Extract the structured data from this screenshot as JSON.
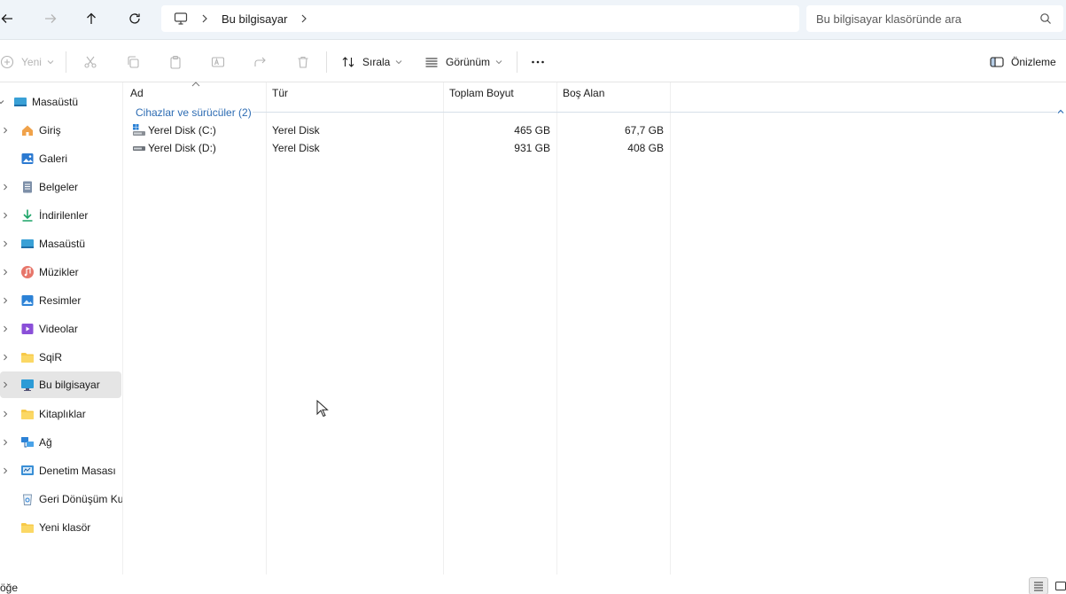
{
  "address": {
    "location": "Bu bilgisayar",
    "search_placeholder": "Bu bilgisayar klasöründe ara"
  },
  "toolbar": {
    "new_label": "Yeni",
    "sort_label": "Sırala",
    "view_label": "Görünüm",
    "preview_label": "Önizleme"
  },
  "sidebar": {
    "items": [
      {
        "label": "Masaüstü",
        "icon": "desktop-icon"
      },
      {
        "label": "Giriş",
        "icon": "home-icon"
      },
      {
        "label": "Galeri",
        "icon": "gallery-icon"
      },
      {
        "label": "Belgeler",
        "icon": "documents-icon"
      },
      {
        "label": "İndirilenler",
        "icon": "download-icon"
      },
      {
        "label": "Masaüstü",
        "icon": "desktop-icon"
      },
      {
        "label": "Müzikler",
        "icon": "music-icon"
      },
      {
        "label": "Resimler",
        "icon": "pictures-icon"
      },
      {
        "label": "Videolar",
        "icon": "video-icon"
      },
      {
        "label": "SqiR",
        "icon": "folder-icon"
      },
      {
        "label": "Bu bilgisayar",
        "icon": "computer-icon"
      },
      {
        "label": "Kitaplıklar",
        "icon": "folder-icon"
      },
      {
        "label": "Ağ",
        "icon": "network-icon"
      },
      {
        "label": "Denetim Masası",
        "icon": "control-panel-icon"
      },
      {
        "label": "Geri Dönüşüm Ku",
        "icon": "recycle-bin-icon"
      },
      {
        "label": "Yeni klasör",
        "icon": "folder-icon"
      }
    ]
  },
  "table": {
    "columns": [
      "Ad",
      "Tür",
      "Toplam Boyut",
      "Boş Alan"
    ],
    "group_label": "Cihazlar ve sürücüler (2)",
    "rows": [
      {
        "name": "Yerel Disk (C:)",
        "type": "Yerel Disk",
        "total": "465 GB",
        "free": "67,7 GB"
      },
      {
        "name": "Yerel Disk (D:)",
        "type": "Yerel Disk",
        "total": "931 GB",
        "free": "408 GB"
      }
    ]
  },
  "status": {
    "count": "öğe"
  },
  "colors": {
    "accent": "#2d6cb3",
    "topbar": "#eff4f9",
    "selected": "#e5e5e5"
  }
}
